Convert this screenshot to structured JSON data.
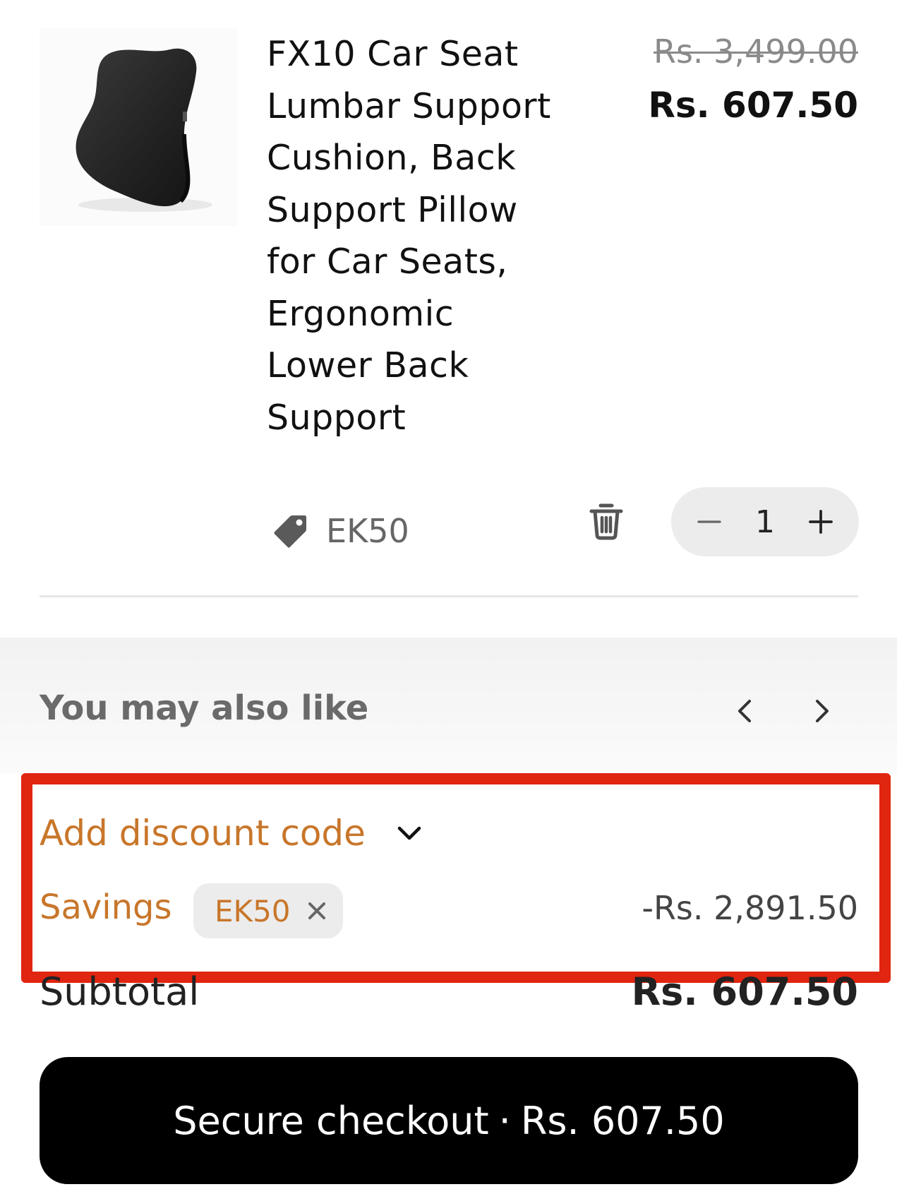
{
  "cart_item": {
    "image_alt": "lumbar-support-cushion",
    "title": "FX10 Car Seat Lumbar Support Cushion, Back Support Pillow for Car Seats, Ergonomic Lower Back Support",
    "price_original": "Rs. 3,499.00",
    "price_current": "Rs. 607.50",
    "discount_code": "EK50",
    "quantity": "1",
    "icons": {
      "tag": "tag-icon",
      "delete": "trash-icon",
      "decrease": "minus-icon",
      "increase": "plus-icon"
    }
  },
  "recommendations": {
    "title": "You may also like",
    "icons": {
      "prev": "chevron-left-icon",
      "next": "chevron-right-icon"
    }
  },
  "summary": {
    "discount_toggle_label": "Add discount code",
    "savings_label": "Savings",
    "applied_code": "EK50",
    "savings_amount": "-Rs. 2,891.50",
    "subtotal_label": "Subtotal",
    "subtotal_amount": "Rs. 607.50",
    "checkout_label": "Secure checkout",
    "checkout_separator": "·",
    "checkout_amount": "Rs. 607.50"
  },
  "colors": {
    "accent": "#c8762a",
    "highlight": "#e02510",
    "checkout_bg": "#000000",
    "chip_bg": "#ececec"
  }
}
